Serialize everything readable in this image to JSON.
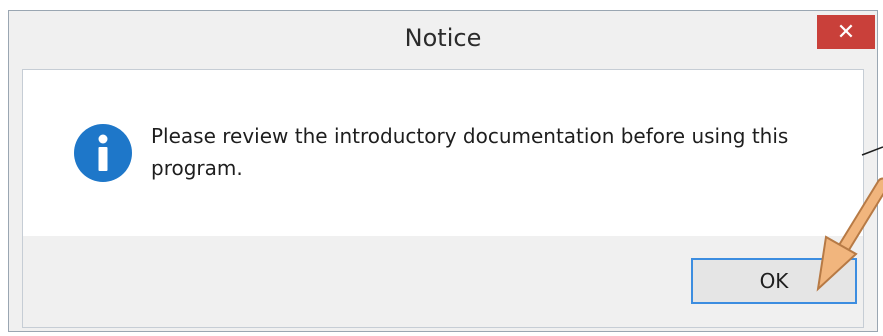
{
  "dialog": {
    "title": "Notice",
    "close_glyph": "✕",
    "message": "Please review the introductory documentation before using this program.",
    "icon": "info-icon",
    "ok_label": "OK"
  },
  "colors": {
    "close_button": "#c9403a",
    "icon_blue": "#1e77c9",
    "ok_border": "#3c8de0",
    "annotation_arrow": "#e8a96a"
  }
}
